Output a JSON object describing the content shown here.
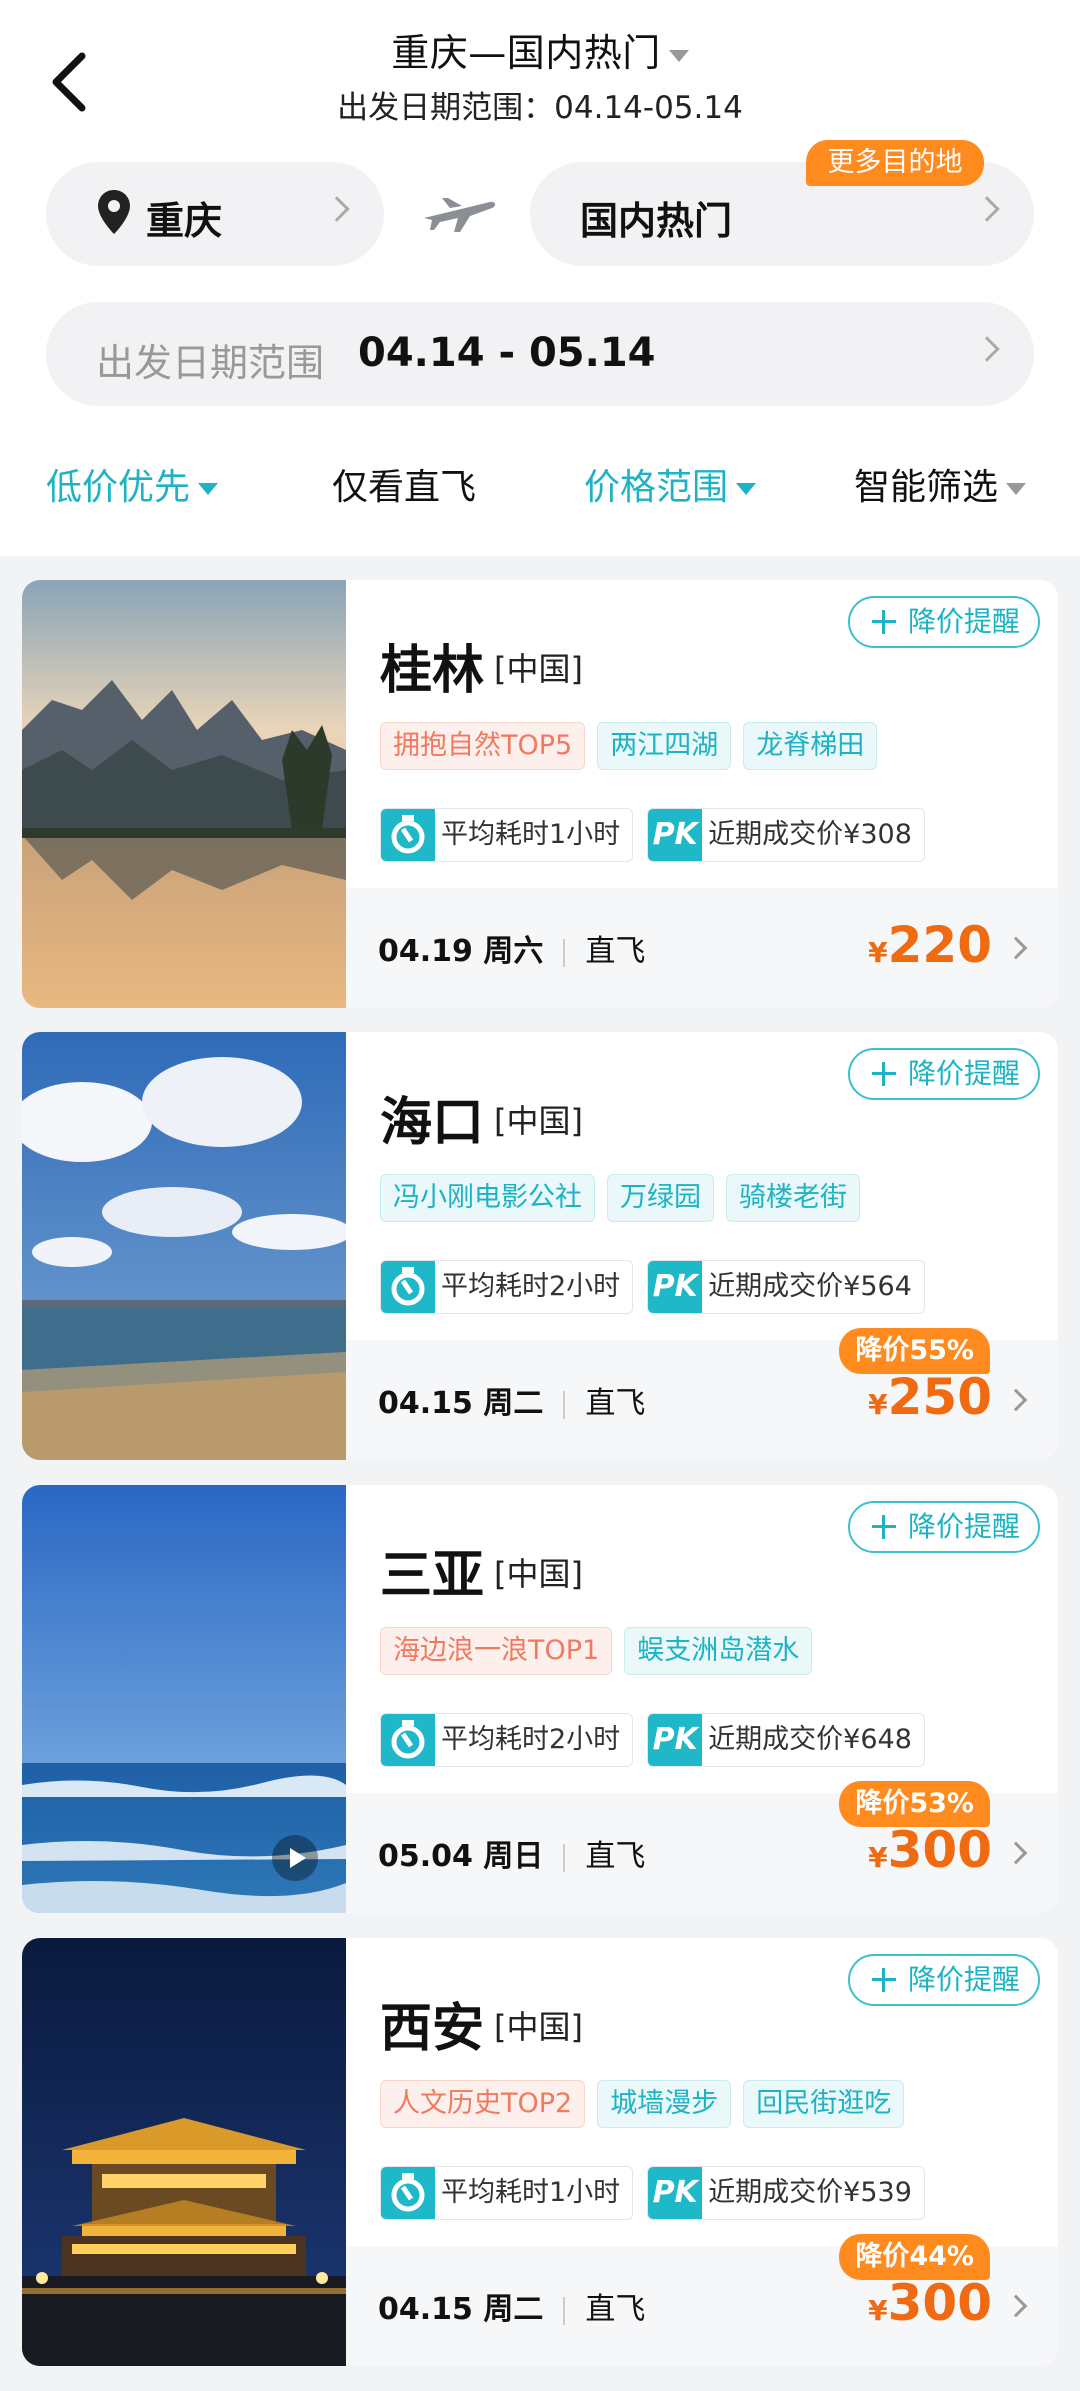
{
  "header": {
    "title": "重庆—国内热门",
    "subtitle": "出发日期范围：04.14-05.14",
    "from_city": "重庆",
    "to_city": "国内热门",
    "more_badge": "更多目的地",
    "date_label": "出发日期范围",
    "date_value": "04.14 - 05.14"
  },
  "filters": [
    {
      "label": "低价优先",
      "active": true
    },
    {
      "label": "仅看直飞",
      "active": false
    },
    {
      "label": "价格范围",
      "active": true
    },
    {
      "label": "智能筛选",
      "active": false
    }
  ],
  "remind_label": "降价提醒",
  "cards": [
    {
      "city": "桂林",
      "country": "[中国]",
      "tags": [
        {
          "text": "拥抱自然TOP5",
          "kind": "rank"
        },
        {
          "text": "两江四湖",
          "kind": "normal"
        },
        {
          "text": "龙脊梯田",
          "kind": "normal"
        }
      ],
      "avg_time": "平均耗时1小时",
      "recent_price": "近期成交价¥308",
      "date": "04.19 周六",
      "flight_type": "直飞",
      "price": "220",
      "discount": ""
    },
    {
      "city": "海口",
      "country": "[中国]",
      "tags": [
        {
          "text": "冯小刚电影公社",
          "kind": "normal"
        },
        {
          "text": "万绿园",
          "kind": "normal"
        },
        {
          "text": "骑楼老街",
          "kind": "normal"
        }
      ],
      "avg_time": "平均耗时2小时",
      "recent_price": "近期成交价¥564",
      "date": "04.15 周二",
      "flight_type": "直飞",
      "price": "250",
      "discount": "降价55%"
    },
    {
      "city": "三亚",
      "country": "[中国]",
      "tags": [
        {
          "text": "海边浪一浪TOP1",
          "kind": "rank"
        },
        {
          "text": "蜈支洲岛潜水",
          "kind": "normal"
        }
      ],
      "avg_time": "平均耗时2小时",
      "recent_price": "近期成交价¥648",
      "date": "05.04 周日",
      "flight_type": "直飞",
      "price": "300",
      "discount": "降价53%"
    },
    {
      "city": "西安",
      "country": "[中国]",
      "tags": [
        {
          "text": "人文历史TOP2",
          "kind": "rank"
        },
        {
          "text": "城墙漫步",
          "kind": "normal"
        },
        {
          "text": "回民街逛吃",
          "kind": "normal"
        }
      ],
      "avg_time": "平均耗时1小时",
      "recent_price": "近期成交价¥539",
      "date": "04.15 周二",
      "flight_type": "直飞",
      "price": "300",
      "discount": "降价44%"
    }
  ],
  "currency_symbol": "¥",
  "pk_label": "PK",
  "colors": {
    "accent": "#1eb3c4",
    "price": "#f06a12",
    "badge": "#ff8b1f"
  }
}
